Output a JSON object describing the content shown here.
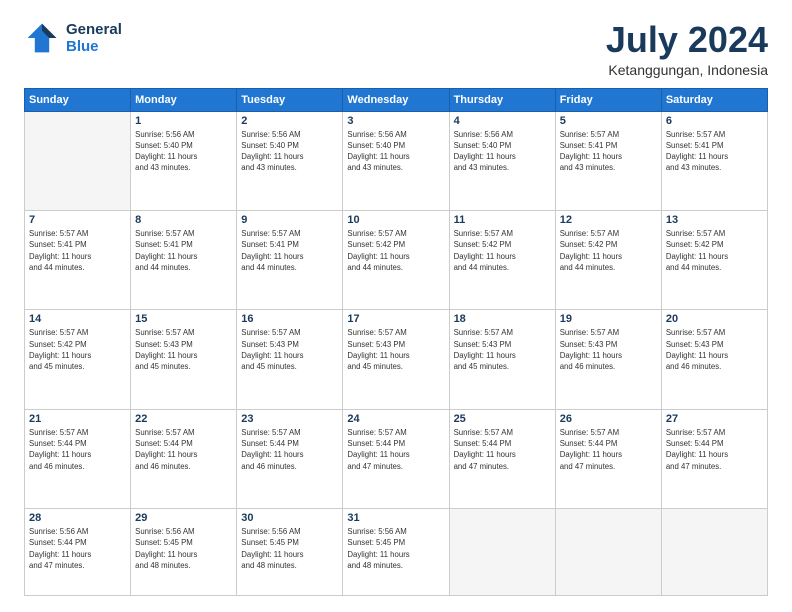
{
  "logo": {
    "line1": "General",
    "line2": "Blue"
  },
  "title": "July 2024",
  "location": "Ketanggungan, Indonesia",
  "weekdays": [
    "Sunday",
    "Monday",
    "Tuesday",
    "Wednesday",
    "Thursday",
    "Friday",
    "Saturday"
  ],
  "weeks": [
    [
      {
        "day": "",
        "info": ""
      },
      {
        "day": "1",
        "info": "Sunrise: 5:56 AM\nSunset: 5:40 PM\nDaylight: 11 hours\nand 43 minutes."
      },
      {
        "day": "2",
        "info": "Sunrise: 5:56 AM\nSunset: 5:40 PM\nDaylight: 11 hours\nand 43 minutes."
      },
      {
        "day": "3",
        "info": "Sunrise: 5:56 AM\nSunset: 5:40 PM\nDaylight: 11 hours\nand 43 minutes."
      },
      {
        "day": "4",
        "info": "Sunrise: 5:56 AM\nSunset: 5:40 PM\nDaylight: 11 hours\nand 43 minutes."
      },
      {
        "day": "5",
        "info": "Sunrise: 5:57 AM\nSunset: 5:41 PM\nDaylight: 11 hours\nand 43 minutes."
      },
      {
        "day": "6",
        "info": "Sunrise: 5:57 AM\nSunset: 5:41 PM\nDaylight: 11 hours\nand 43 minutes."
      }
    ],
    [
      {
        "day": "7",
        "info": "Sunrise: 5:57 AM\nSunset: 5:41 PM\nDaylight: 11 hours\nand 44 minutes."
      },
      {
        "day": "8",
        "info": "Sunrise: 5:57 AM\nSunset: 5:41 PM\nDaylight: 11 hours\nand 44 minutes."
      },
      {
        "day": "9",
        "info": "Sunrise: 5:57 AM\nSunset: 5:41 PM\nDaylight: 11 hours\nand 44 minutes."
      },
      {
        "day": "10",
        "info": "Sunrise: 5:57 AM\nSunset: 5:42 PM\nDaylight: 11 hours\nand 44 minutes."
      },
      {
        "day": "11",
        "info": "Sunrise: 5:57 AM\nSunset: 5:42 PM\nDaylight: 11 hours\nand 44 minutes."
      },
      {
        "day": "12",
        "info": "Sunrise: 5:57 AM\nSunset: 5:42 PM\nDaylight: 11 hours\nand 44 minutes."
      },
      {
        "day": "13",
        "info": "Sunrise: 5:57 AM\nSunset: 5:42 PM\nDaylight: 11 hours\nand 44 minutes."
      }
    ],
    [
      {
        "day": "14",
        "info": "Sunrise: 5:57 AM\nSunset: 5:42 PM\nDaylight: 11 hours\nand 45 minutes."
      },
      {
        "day": "15",
        "info": "Sunrise: 5:57 AM\nSunset: 5:43 PM\nDaylight: 11 hours\nand 45 minutes."
      },
      {
        "day": "16",
        "info": "Sunrise: 5:57 AM\nSunset: 5:43 PM\nDaylight: 11 hours\nand 45 minutes."
      },
      {
        "day": "17",
        "info": "Sunrise: 5:57 AM\nSunset: 5:43 PM\nDaylight: 11 hours\nand 45 minutes."
      },
      {
        "day": "18",
        "info": "Sunrise: 5:57 AM\nSunset: 5:43 PM\nDaylight: 11 hours\nand 45 minutes."
      },
      {
        "day": "19",
        "info": "Sunrise: 5:57 AM\nSunset: 5:43 PM\nDaylight: 11 hours\nand 46 minutes."
      },
      {
        "day": "20",
        "info": "Sunrise: 5:57 AM\nSunset: 5:43 PM\nDaylight: 11 hours\nand 46 minutes."
      }
    ],
    [
      {
        "day": "21",
        "info": "Sunrise: 5:57 AM\nSunset: 5:44 PM\nDaylight: 11 hours\nand 46 minutes."
      },
      {
        "day": "22",
        "info": "Sunrise: 5:57 AM\nSunset: 5:44 PM\nDaylight: 11 hours\nand 46 minutes."
      },
      {
        "day": "23",
        "info": "Sunrise: 5:57 AM\nSunset: 5:44 PM\nDaylight: 11 hours\nand 46 minutes."
      },
      {
        "day": "24",
        "info": "Sunrise: 5:57 AM\nSunset: 5:44 PM\nDaylight: 11 hours\nand 47 minutes."
      },
      {
        "day": "25",
        "info": "Sunrise: 5:57 AM\nSunset: 5:44 PM\nDaylight: 11 hours\nand 47 minutes."
      },
      {
        "day": "26",
        "info": "Sunrise: 5:57 AM\nSunset: 5:44 PM\nDaylight: 11 hours\nand 47 minutes."
      },
      {
        "day": "27",
        "info": "Sunrise: 5:57 AM\nSunset: 5:44 PM\nDaylight: 11 hours\nand 47 minutes."
      }
    ],
    [
      {
        "day": "28",
        "info": "Sunrise: 5:56 AM\nSunset: 5:44 PM\nDaylight: 11 hours\nand 47 minutes."
      },
      {
        "day": "29",
        "info": "Sunrise: 5:56 AM\nSunset: 5:45 PM\nDaylight: 11 hours\nand 48 minutes."
      },
      {
        "day": "30",
        "info": "Sunrise: 5:56 AM\nSunset: 5:45 PM\nDaylight: 11 hours\nand 48 minutes."
      },
      {
        "day": "31",
        "info": "Sunrise: 5:56 AM\nSunset: 5:45 PM\nDaylight: 11 hours\nand 48 minutes."
      },
      {
        "day": "",
        "info": ""
      },
      {
        "day": "",
        "info": ""
      },
      {
        "day": "",
        "info": ""
      }
    ]
  ]
}
